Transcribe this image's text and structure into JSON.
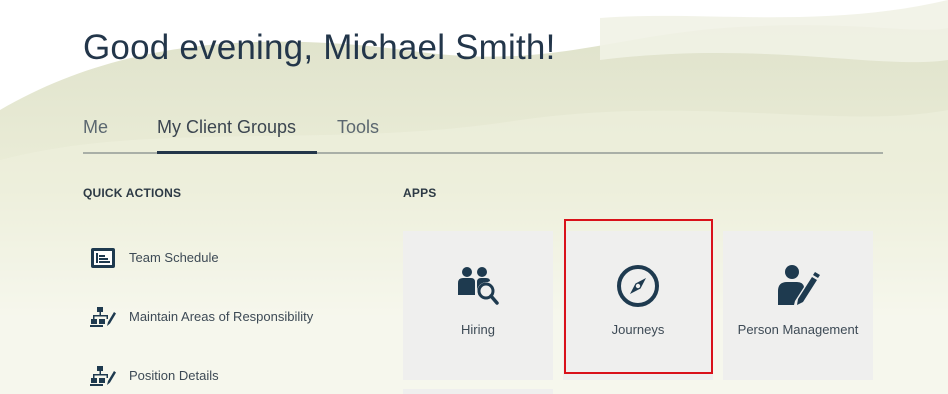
{
  "greeting": "Good evening, Michael Smith!",
  "tabs": [
    {
      "label": "Me"
    },
    {
      "label": "My Client Groups"
    },
    {
      "label": "Tools"
    }
  ],
  "quick_actions": {
    "title": "QUICK ACTIONS",
    "items": [
      {
        "label": "Team Schedule",
        "icon": "team-schedule-icon"
      },
      {
        "label": "Maintain Areas of Responsibility",
        "icon": "org-hierarchy-edit-icon"
      },
      {
        "label": "Position Details",
        "icon": "org-hierarchy-edit-icon"
      }
    ]
  },
  "apps": {
    "title": "APPS",
    "items": [
      {
        "label": "Hiring",
        "icon": "people-search-icon"
      },
      {
        "label": "Journeys",
        "icon": "compass-icon"
      },
      {
        "label": "Person Management",
        "icon": "person-edit-icon"
      }
    ]
  },
  "colors": {
    "text_dark": "#23364a",
    "icon_dark": "#1e3a4f",
    "tile_bg": "#efefee",
    "highlight": "#d9121a"
  }
}
